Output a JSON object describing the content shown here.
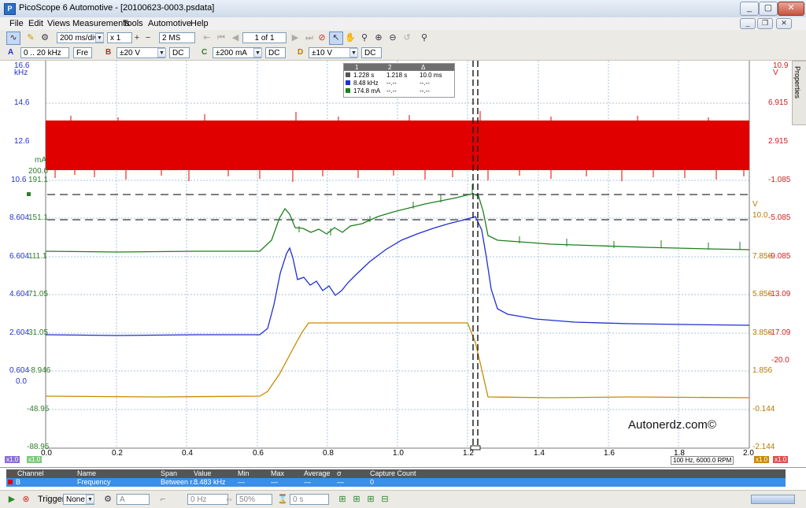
{
  "window": {
    "title": "PicoScope 6 Automotive - [20100623-0003.psdata]"
  },
  "menu": [
    "File",
    "Edit",
    "Views",
    "Measurements",
    "Tools",
    "Automotive",
    "Help"
  ],
  "toolbar": {
    "timebase": "200 ms/div",
    "zoom": "x 1",
    "samples": "2 MS",
    "page": "1 of 1"
  },
  "channels": {
    "a": {
      "letter": "A",
      "range": "0 .. 20 kHz",
      "coupling": "Fre"
    },
    "b": {
      "letter": "B",
      "range": "±20 V",
      "coupling": "DC"
    },
    "c": {
      "letter": "C",
      "range": "±200 mA",
      "coupling": "DC"
    },
    "d": {
      "letter": "D",
      "range": "±10 V",
      "coupling": "DC"
    }
  },
  "axes": {
    "left_blue": [
      "16.6",
      "14.6",
      "12.6",
      "10.6",
      "8.604",
      "6.604",
      "4.604",
      "2.604",
      "0.604",
      "0.0"
    ],
    "left_blue_unit": "kHz",
    "left_green": [
      "200.0",
      "191.1",
      "151.1",
      "111.1",
      "71.05",
      "31.05",
      "-8.946",
      "-48.95",
      "-88.95"
    ],
    "left_green_unit": "mA",
    "right_red": [
      "10.9",
      "6.915",
      "2.915",
      "-1.085",
      "-5.085",
      "-9.085",
      "-13.09",
      "-17.09",
      "-20.0"
    ],
    "right_red_unit": "V",
    "right_orange": [
      "10.0",
      "7.856",
      "5.856",
      "3.856",
      "1.856",
      "-0.144",
      "-2.144"
    ],
    "right_orange_unit": "V",
    "x_ticks": [
      "0.0",
      "0.2",
      "0.4",
      "0.6",
      "0.8",
      "1.0",
      "1.2",
      "1.4",
      "1.6",
      "1.8",
      "2.0"
    ]
  },
  "rulers": {
    "headers": [
      "1",
      "2",
      "Δ"
    ],
    "rows": [
      [
        "1.228 s",
        "1.218 s",
        "10.0 ms"
      ],
      [
        "8.48 kHz",
        "--.--",
        "--.--"
      ],
      [
        "174.8 mA",
        "--.--",
        "--.--"
      ]
    ]
  },
  "watermark": "Autonerdz.com©",
  "rpm_readout": "100 Hz, 6000.0 RPM",
  "scale_badges": {
    "left1": "x1.0",
    "left2": "x1.0",
    "right1": "x1.0",
    "right2": "x1.0"
  },
  "measurements": {
    "headers": [
      "Channel",
      "Name",
      "Span",
      "Value",
      "Min",
      "Max",
      "Average",
      "σ",
      "Capture Count"
    ],
    "row": [
      "B",
      "Frequency",
      "Between r...",
      "8.483 kHz",
      "—",
      "—",
      "—",
      "—",
      "0"
    ]
  },
  "statusbar": {
    "trigger_label": "Trigger",
    "trigger_mode": "None",
    "trigger_channel": "A",
    "threshold": "0 Hz",
    "pretrigger": "50%",
    "delay": "0 s"
  },
  "properties_tab": "Properties",
  "colors": {
    "red": "#e00000",
    "green": "#1f7f1f",
    "blue": "#1f2fd0",
    "orange": "#c98a00"
  }
}
